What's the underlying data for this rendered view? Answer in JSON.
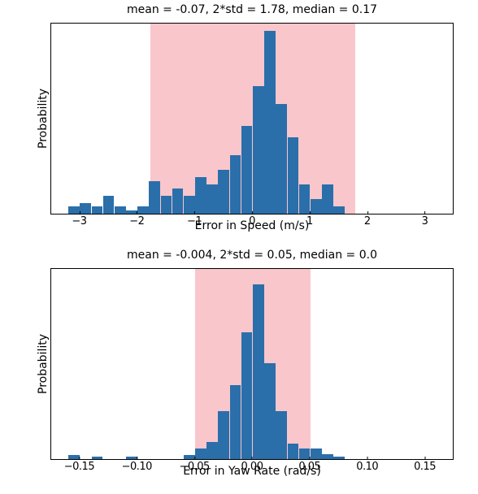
{
  "chart_data": [
    {
      "type": "bar",
      "title": "mean = -0.07,  2*std = 1.78,  median = 0.17",
      "xlabel": "Error in Speed (m/s)",
      "ylabel": "Probability",
      "xlim": [
        -3.5,
        3.5
      ],
      "ylim": [
        0,
        0.105
      ],
      "xticks": [
        "−3",
        "−2",
        "−1",
        "0",
        "1",
        "2",
        "3"
      ],
      "band": {
        "from": -1.78,
        "to": 1.78,
        "color": "#f9c6cc"
      },
      "bin_width": 0.2,
      "bins": [
        {
          "x": -3.1,
          "p": 0.004
        },
        {
          "x": -2.9,
          "p": 0.006
        },
        {
          "x": -2.7,
          "p": 0.004
        },
        {
          "x": -2.5,
          "p": 0.01
        },
        {
          "x": -2.3,
          "p": 0.004
        },
        {
          "x": -2.1,
          "p": 0.002
        },
        {
          "x": -1.9,
          "p": 0.004
        },
        {
          "x": -1.7,
          "p": 0.018
        },
        {
          "x": -1.5,
          "p": 0.01
        },
        {
          "x": -1.3,
          "p": 0.014
        },
        {
          "x": -1.1,
          "p": 0.01
        },
        {
          "x": -0.9,
          "p": 0.02
        },
        {
          "x": -0.7,
          "p": 0.016
        },
        {
          "x": -0.5,
          "p": 0.024
        },
        {
          "x": -0.3,
          "p": 0.032
        },
        {
          "x": -0.1,
          "p": 0.048
        },
        {
          "x": 0.1,
          "p": 0.07
        },
        {
          "x": 0.3,
          "p": 0.1
        },
        {
          "x": 0.5,
          "p": 0.06
        },
        {
          "x": 0.7,
          "p": 0.042
        },
        {
          "x": 0.9,
          "p": 0.016
        },
        {
          "x": 1.1,
          "p": 0.008
        },
        {
          "x": 1.3,
          "p": 0.016
        },
        {
          "x": 1.5,
          "p": 0.004
        }
      ]
    },
    {
      "type": "bar",
      "title": "mean = -0.004,  2*std = 0.05,  median = 0.0",
      "xlabel": "Error in Yaw Rate (rad/s)",
      "ylabel": "Probability",
      "xlim": [
        -0.175,
        0.175
      ],
      "ylim": [
        0,
        0.22
      ],
      "xticks": [
        "−0.15",
        "−0.10",
        "−0.05",
        "0.00",
        "0.05",
        "0.10",
        "0.15"
      ],
      "band": {
        "from": -0.05,
        "to": 0.05,
        "color": "#f9c6cc"
      },
      "bin_width": 0.01,
      "bins": [
        {
          "x": -0.155,
          "p": 0.005
        },
        {
          "x": -0.135,
          "p": 0.003
        },
        {
          "x": -0.105,
          "p": 0.003
        },
        {
          "x": -0.055,
          "p": 0.005
        },
        {
          "x": -0.045,
          "p": 0.012
        },
        {
          "x": -0.035,
          "p": 0.02
        },
        {
          "x": -0.025,
          "p": 0.055
        },
        {
          "x": -0.015,
          "p": 0.085
        },
        {
          "x": -0.005,
          "p": 0.145
        },
        {
          "x": 0.005,
          "p": 0.2
        },
        {
          "x": 0.015,
          "p": 0.11
        },
        {
          "x": 0.025,
          "p": 0.055
        },
        {
          "x": 0.035,
          "p": 0.018
        },
        {
          "x": 0.045,
          "p": 0.012
        },
        {
          "x": 0.055,
          "p": 0.012
        },
        {
          "x": 0.065,
          "p": 0.006
        },
        {
          "x": 0.075,
          "p": 0.003
        }
      ]
    }
  ],
  "panel_tops": [
    28,
    330
  ]
}
